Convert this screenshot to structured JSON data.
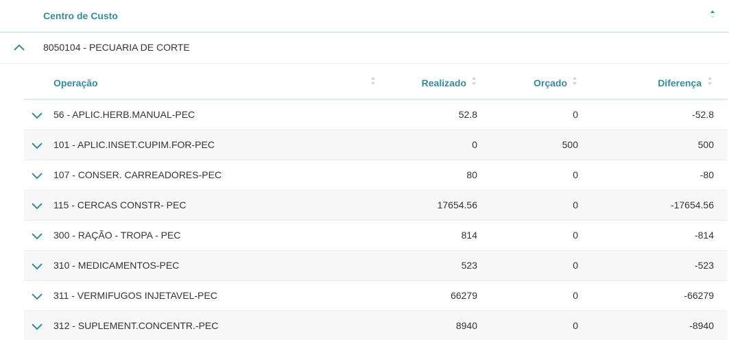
{
  "table": {
    "header": {
      "column": "Centro de Custo"
    },
    "group": {
      "label": "8050104 - PECUARIA DE CORTE",
      "expanded": true
    },
    "inner_headers": {
      "operacao": "Operação",
      "realizado": "Realizado",
      "orcado": "Orçado",
      "diferenca": "Diferença"
    },
    "rows": [
      {
        "operacao": "56 - APLIC.HERB.MANUAL-PEC",
        "realizado": "52.8",
        "orcado": "0",
        "diferenca": "-52.8"
      },
      {
        "operacao": "101 - APLIC.INSET.CUPIM.FOR-PEC",
        "realizado": "0",
        "orcado": "500",
        "diferenca": "500"
      },
      {
        "operacao": "107 - CONSER. CARREADORES-PEC",
        "realizado": "80",
        "orcado": "0",
        "diferenca": "-80"
      },
      {
        "operacao": "115 - CERCAS CONSTR- PEC",
        "realizado": "17654.56",
        "orcado": "0",
        "diferenca": "-17654.56"
      },
      {
        "operacao": "300 - RAÇÃO - TROPA - PEC",
        "realizado": "814",
        "orcado": "0",
        "diferenca": "-814"
      },
      {
        "operacao": "310 - MEDICAMENTOS-PEC",
        "realizado": "523",
        "orcado": "0",
        "diferenca": "-523"
      },
      {
        "operacao": "311 - VERMIFUGOS INJETAVEL-PEC",
        "realizado": "66279",
        "orcado": "0",
        "diferenca": "-66279"
      },
      {
        "operacao": "312 - SUPLEMENT.CONCENTR.-PEC",
        "realizado": "8940",
        "orcado": "0",
        "diferenca": "-8940"
      }
    ]
  },
  "colors": {
    "accent": "#2e8da0",
    "header_border": "#d7ecef",
    "row_alt": "#f7f7f7"
  },
  "icons": {
    "sort_outer": "sort-asc-icon",
    "group_toggle": "chevron-up-icon",
    "row_toggle": "chevron-down-icon",
    "sort": "sort-icon"
  }
}
